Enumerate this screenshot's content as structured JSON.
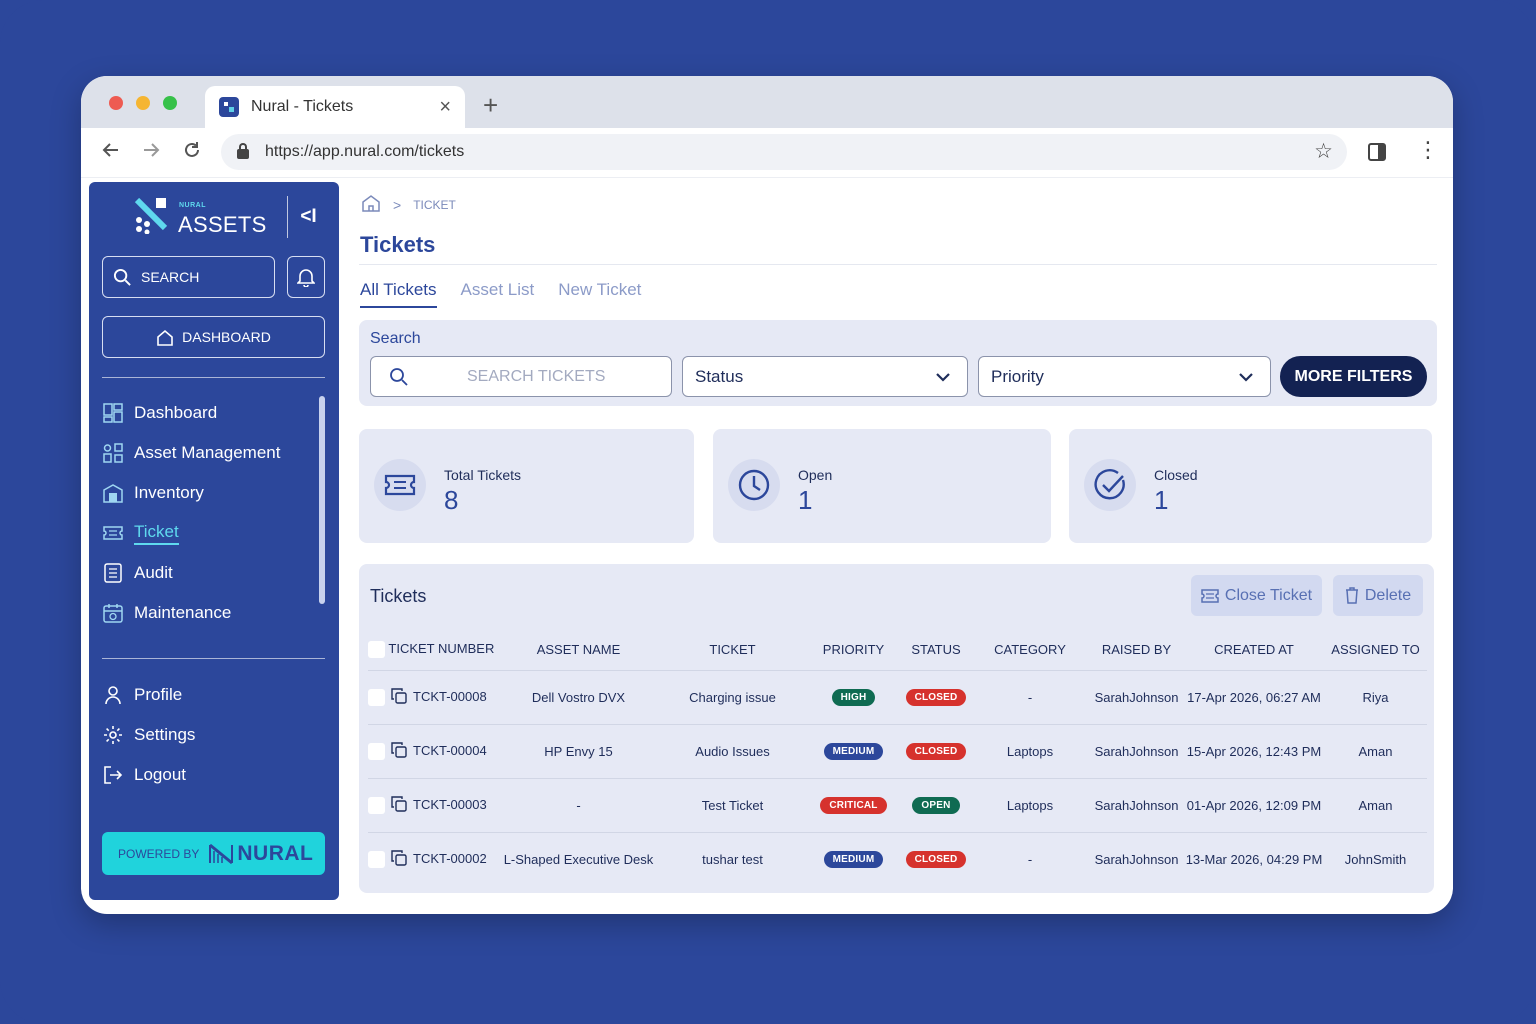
{
  "browser": {
    "tab_title": "Nural - Tickets",
    "url": "https://app.nural.com/tickets"
  },
  "sidebar": {
    "brand_small": "NURAL",
    "brand": "ASSETS",
    "collapse_label": "<I",
    "search_label": "SEARCH",
    "dashboard_button": "DASHBOARD",
    "menu": [
      {
        "label": "Dashboard",
        "icon": "dashboard-icon"
      },
      {
        "label": "Asset Management",
        "icon": "asset-management-icon"
      },
      {
        "label": "Inventory",
        "icon": "inventory-icon"
      },
      {
        "label": "Ticket",
        "icon": "ticket-icon",
        "active": true
      },
      {
        "label": "Audit",
        "icon": "audit-icon"
      },
      {
        "label": "Maintenance",
        "icon": "maintenance-icon"
      }
    ],
    "account_menu": [
      {
        "label": "Profile",
        "icon": "profile-icon"
      },
      {
        "label": "Settings",
        "icon": "settings-icon"
      },
      {
        "label": "Logout",
        "icon": "logout-icon"
      }
    ],
    "powered_by_label": "POWERED BY",
    "powered_by_brand": "NURAL"
  },
  "main": {
    "breadcrumb": {
      "current": "TICKET"
    },
    "title": "Tickets",
    "tabs": [
      {
        "label": "All Tickets",
        "active": true
      },
      {
        "label": "Asset List"
      },
      {
        "label": "New Ticket"
      }
    ],
    "filters": {
      "label": "Search",
      "search_placeholder": "SEARCH TICKETS",
      "status_value": "Status",
      "priority_value": "Priority",
      "more_filters": "MORE FILTERS"
    },
    "stats": [
      {
        "label": "Total Tickets",
        "value": "8",
        "icon": "ticket-icon"
      },
      {
        "label": "Open",
        "value": "1",
        "icon": "clock-icon"
      },
      {
        "label": "Closed",
        "value": "1",
        "icon": "check-circle-icon"
      }
    ],
    "table": {
      "title": "Tickets",
      "close_ticket": "Close Ticket",
      "delete": "Delete",
      "columns": [
        "TICKET NUMBER",
        "ASSET NAME",
        "TICKET",
        "PRIORITY",
        "STATUS",
        "CATEGORY",
        "RAISED BY",
        "CREATED AT",
        "ASSIGNED TO"
      ],
      "rows": [
        {
          "ticket_number": "TCKT-00008",
          "asset_name": "Dell Vostro DVX",
          "ticket": "Charging issue",
          "priority": "HIGH",
          "status": "CLOSED",
          "category": "-",
          "raised_by": "SarahJohnson",
          "created_at": "17-Apr 2026, 06:27 AM",
          "assigned_to": "Riya"
        },
        {
          "ticket_number": "TCKT-00004",
          "asset_name": "HP Envy 15",
          "ticket": "Audio Issues",
          "priority": "MEDIUM",
          "status": "CLOSED",
          "category": "Laptops",
          "raised_by": "SarahJohnson",
          "created_at": "15-Apr 2026, 12:43 PM",
          "assigned_to": "Aman"
        },
        {
          "ticket_number": "TCKT-00003",
          "asset_name": "-",
          "ticket": "Test Ticket",
          "priority": "CRITICAL",
          "status": "OPEN",
          "category": "Laptops",
          "raised_by": "SarahJohnson",
          "created_at": "01-Apr 2026, 12:09 PM",
          "assigned_to": "Aman"
        },
        {
          "ticket_number": "TCKT-00002",
          "asset_name": "L-Shaped Executive Desk",
          "ticket": "tushar test",
          "priority": "MEDIUM",
          "status": "CLOSED",
          "category": "-",
          "raised_by": "SarahJohnson",
          "created_at": "13-Mar 2026, 04:29 PM",
          "assigned_to": "JohnSmith"
        }
      ]
    }
  },
  "colors": {
    "brand_blue": "#2c479b",
    "accent_cyan": "#20d3dc",
    "navy_button": "#132252",
    "badge_red": "#d6322d",
    "badge_green": "#0f6b52"
  }
}
